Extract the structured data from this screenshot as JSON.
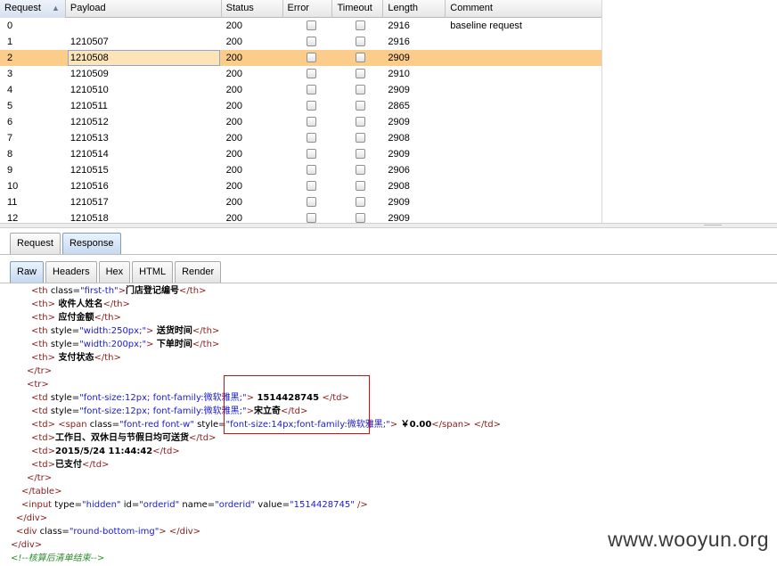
{
  "results_table": {
    "headers": {
      "request": "Request",
      "payload": "Payload",
      "status": "Status",
      "error": "Error",
      "timeout": "Timeout",
      "length": "Length",
      "comment": "Comment"
    },
    "sort_indicator": "▲",
    "rows": [
      {
        "request": "0",
        "payload": "",
        "status": "200",
        "length": "2916",
        "comment": "baseline request"
      },
      {
        "request": "1",
        "payload": "1210507",
        "status": "200",
        "length": "2916",
        "comment": ""
      },
      {
        "request": "2",
        "payload": "1210508",
        "status": "200",
        "length": "2909",
        "comment": ""
      },
      {
        "request": "3",
        "payload": "1210509",
        "status": "200",
        "length": "2910",
        "comment": ""
      },
      {
        "request": "4",
        "payload": "1210510",
        "status": "200",
        "length": "2909",
        "comment": ""
      },
      {
        "request": "5",
        "payload": "1210511",
        "status": "200",
        "length": "2865",
        "comment": ""
      },
      {
        "request": "6",
        "payload": "1210512",
        "status": "200",
        "length": "2909",
        "comment": ""
      },
      {
        "request": "7",
        "payload": "1210513",
        "status": "200",
        "length": "2908",
        "comment": ""
      },
      {
        "request": "8",
        "payload": "1210514",
        "status": "200",
        "length": "2909",
        "comment": ""
      },
      {
        "request": "9",
        "payload": "1210515",
        "status": "200",
        "length": "2906",
        "comment": ""
      },
      {
        "request": "10",
        "payload": "1210516",
        "status": "200",
        "length": "2908",
        "comment": ""
      },
      {
        "request": "11",
        "payload": "1210517",
        "status": "200",
        "length": "2909",
        "comment": ""
      },
      {
        "request": "12",
        "payload": "1210518",
        "status": "200",
        "length": "2909",
        "comment": ""
      }
    ]
  },
  "tabs_top": [
    "Request",
    "Response"
  ],
  "tabs_sub": [
    "Raw",
    "Headers",
    "Hex",
    "HTML",
    "Render"
  ],
  "code_lines": [
    {
      "parts": [
        {
          "c": "tag",
          "t": "<th "
        },
        {
          "c": "attr",
          "t": "class="
        },
        {
          "c": "val",
          "t": "\"first-th\""
        },
        {
          "c": "tag",
          "t": ">"
        },
        {
          "c": "txt",
          "t": "门店登记编号"
        },
        {
          "c": "tag",
          "t": "</th>"
        }
      ]
    },
    {
      "parts": [
        {
          "c": "tag",
          "t": "<th>"
        },
        {
          "c": "txt",
          "t": " 收件人姓名"
        },
        {
          "c": "tag",
          "t": "</th>"
        }
      ]
    },
    {
      "parts": [
        {
          "c": "tag",
          "t": "<th>"
        },
        {
          "c": "txt",
          "t": " 应付金额"
        },
        {
          "c": "tag",
          "t": "</th>"
        }
      ]
    },
    {
      "parts": [
        {
          "c": "tag",
          "t": "<th "
        },
        {
          "c": "attr",
          "t": "style="
        },
        {
          "c": "val",
          "t": "\"width:250px;\""
        },
        {
          "c": "tag",
          "t": ">"
        },
        {
          "c": "txt",
          "t": " 送货时间"
        },
        {
          "c": "tag",
          "t": "</th>"
        }
      ]
    },
    {
      "parts": [
        {
          "c": "tag",
          "t": "<th "
        },
        {
          "c": "attr",
          "t": "style="
        },
        {
          "c": "val",
          "t": "\"width:200px;\""
        },
        {
          "c": "tag",
          "t": ">"
        },
        {
          "c": "txt",
          "t": " 下单时间"
        },
        {
          "c": "tag",
          "t": "</th>"
        }
      ]
    },
    {
      "parts": [
        {
          "c": "tag",
          "t": "<th>"
        },
        {
          "c": "txt",
          "t": " 支付状态"
        },
        {
          "c": "tag",
          "t": "</th>"
        }
      ]
    },
    {
      "parts": [
        {
          "c": "tag",
          "t": "</tr>"
        }
      ]
    },
    {
      "parts": [
        {
          "c": "tag",
          "t": "<tr>"
        }
      ]
    },
    {
      "parts": [
        {
          "c": "tag",
          "t": "<td "
        },
        {
          "c": "attr",
          "t": "style="
        },
        {
          "c": "val",
          "t": "\"font-size:12px; font-family:微软雅黑;\""
        },
        {
          "c": "tag",
          "t": ">"
        },
        {
          "c": "txt",
          "t": " 1514428745 "
        },
        {
          "c": "tag",
          "t": "</td>"
        }
      ]
    },
    {
      "parts": [
        {
          "c": "tag",
          "t": "<td "
        },
        {
          "c": "attr",
          "t": "style="
        },
        {
          "c": "val",
          "t": "\"font-size:12px; font-family:微软雅黑;\""
        },
        {
          "c": "tag",
          "t": ">"
        },
        {
          "c": "txt",
          "t": "宋立奇"
        },
        {
          "c": "tag",
          "t": "</td>"
        }
      ]
    },
    {
      "parts": [
        {
          "c": "tag",
          "t": "<td> <span "
        },
        {
          "c": "attr",
          "t": "class="
        },
        {
          "c": "val",
          "t": "\"font-red font-w\""
        },
        {
          "c": "attr",
          "t": " style="
        },
        {
          "c": "val",
          "t": "\"font-size:14px;font-family:微软雅黑;\""
        },
        {
          "c": "tag",
          "t": ">"
        },
        {
          "c": "txt",
          "t": " ￥0.00"
        },
        {
          "c": "tag",
          "t": "</span> </td>"
        }
      ]
    },
    {
      "parts": [
        {
          "c": "tag",
          "t": "<td>"
        },
        {
          "c": "txt",
          "t": "工作日、双休日与节假日均可送货"
        },
        {
          "c": "tag",
          "t": "</td>"
        }
      ]
    },
    {
      "parts": [
        {
          "c": "tag",
          "t": "<td>"
        },
        {
          "c": "txt",
          "t": "2015/5/24 11:44:42"
        },
        {
          "c": "tag",
          "t": "</td>"
        }
      ]
    },
    {
      "parts": [
        {
          "c": "tag",
          "t": "<td>"
        },
        {
          "c": "txt",
          "t": "已支付"
        },
        {
          "c": "tag",
          "t": "</td>"
        }
      ]
    },
    {
      "parts": [
        {
          "c": "tag",
          "t": "</tr>"
        }
      ]
    },
    {
      "parts": [
        {
          "c": "tag",
          "t": "</table>"
        }
      ]
    },
    {
      "parts": [
        {
          "c": "tag",
          "t": "<input "
        },
        {
          "c": "attr",
          "t": "type="
        },
        {
          "c": "val",
          "t": "\"hidden\""
        },
        {
          "c": "attr",
          "t": " id="
        },
        {
          "c": "val",
          "t": "\"orderid\""
        },
        {
          "c": "attr",
          "t": " name="
        },
        {
          "c": "val",
          "t": "\"orderid\""
        },
        {
          "c": "attr",
          "t": " value="
        },
        {
          "c": "val",
          "t": "\"1514428745\""
        },
        {
          "c": "tag",
          "t": " />"
        }
      ]
    },
    {
      "parts": [
        {
          "c": "tag",
          "t": "</div>"
        }
      ]
    },
    {
      "parts": [
        {
          "c": "tag",
          "t": "<div "
        },
        {
          "c": "attr",
          "t": "class="
        },
        {
          "c": "val",
          "t": "\"round-bottom-img\""
        },
        {
          "c": "tag",
          "t": "> </div>"
        }
      ]
    },
    {
      "parts": [
        {
          "c": "tag",
          "t": "</div>"
        }
      ]
    },
    {
      "parts": [
        {
          "c": "cmt",
          "t": "<!--核算后清单结束-->"
        }
      ]
    }
  ],
  "watermark": "www.wooyun.org"
}
